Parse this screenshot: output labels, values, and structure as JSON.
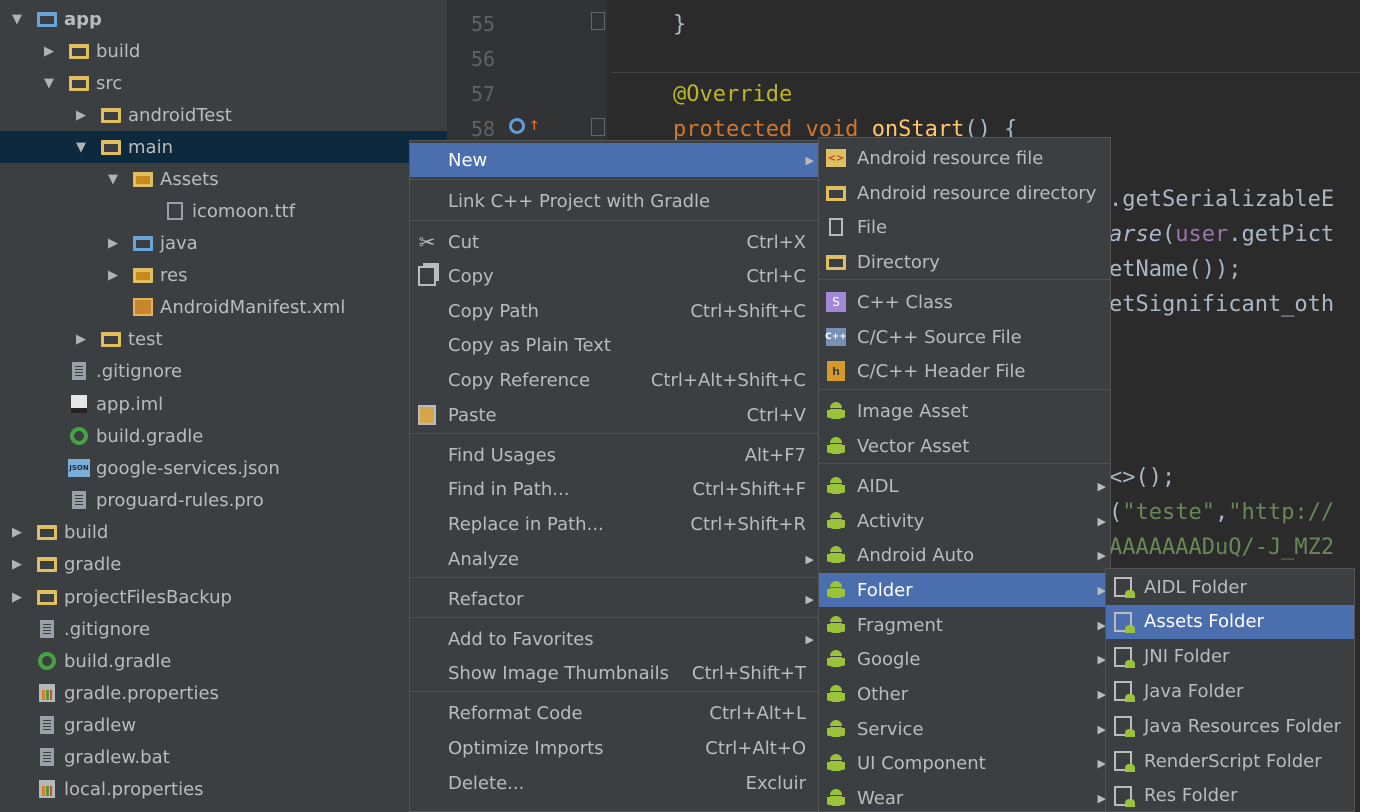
{
  "tree": {
    "items": [
      {
        "label": "app",
        "bold": true,
        "icon": "module-folder-icon",
        "arrow": "expanded"
      },
      {
        "label": "build",
        "icon": "folder-icon",
        "arrow": "collapsed"
      },
      {
        "label": "src",
        "icon": "folder-icon",
        "arrow": "expanded"
      },
      {
        "label": "androidTest",
        "icon": "folder-icon",
        "arrow": "collapsed"
      },
      {
        "label": "main",
        "icon": "folder-icon",
        "arrow": "expanded",
        "selected": true
      },
      {
        "label": "Assets",
        "icon": "assets-folder-icon",
        "arrow": "expanded"
      },
      {
        "label": "icomoon.ttf",
        "icon": "font-file-icon",
        "arrow": "none"
      },
      {
        "label": "java",
        "icon": "source-folder-icon",
        "arrow": "collapsed"
      },
      {
        "label": "res",
        "icon": "resource-folder-icon",
        "arrow": "collapsed"
      },
      {
        "label": "AndroidManifest.xml",
        "icon": "manifest-icon",
        "arrow": "none"
      },
      {
        "label": "test",
        "icon": "folder-icon",
        "arrow": "collapsed"
      },
      {
        "label": ".gitignore",
        "icon": "text-file-icon",
        "arrow": "none"
      },
      {
        "label": "app.iml",
        "icon": "iml-file-icon",
        "arrow": "none"
      },
      {
        "label": "build.gradle",
        "icon": "gradle-icon",
        "arrow": "none"
      },
      {
        "label": "google-services.json",
        "icon": "json-file-icon",
        "arrow": "none"
      },
      {
        "label": "proguard-rules.pro",
        "icon": "text-file-icon",
        "arrow": "none"
      },
      {
        "label": "build",
        "icon": "folder-icon",
        "arrow": "collapsed"
      },
      {
        "label": "gradle",
        "icon": "folder-icon",
        "arrow": "collapsed"
      },
      {
        "label": "projectFilesBackup",
        "icon": "folder-icon",
        "arrow": "collapsed"
      },
      {
        "label": ".gitignore",
        "icon": "text-file-icon",
        "arrow": "none"
      },
      {
        "label": "build.gradle",
        "icon": "gradle-icon",
        "arrow": "none"
      },
      {
        "label": "gradle.properties",
        "icon": "properties-icon",
        "arrow": "none"
      },
      {
        "label": "gradlew",
        "icon": "text-file-icon",
        "arrow": "none"
      },
      {
        "label": "gradlew.bat",
        "icon": "text-file-icon",
        "arrow": "none"
      },
      {
        "label": "local.properties",
        "icon": "properties-icon",
        "arrow": "none"
      }
    ]
  },
  "editor": {
    "line_numbers": [
      "55",
      "56",
      "57",
      "58"
    ],
    "lines": {
      "l55": "}",
      "l57": "@Override",
      "l58_kw": "protected void ",
      "l58_fn": "onStart",
      "l58_rest": "() {",
      "r1": ".getSerializableE",
      "r2a": "arse",
      "r2b": "(",
      "r2c": "user",
      "r2d": ".getPict",
      "r3a": "etName());",
      "r4": "etSignificant_oth",
      "r5": "<>();",
      "r6a": "(",
      "r6b": "\"teste\"",
      "r6c": ",",
      "r6d": "\"http://",
      "r7": "AAAAAAADuQ/-J_MZ2"
    }
  },
  "context_menu": {
    "items": [
      {
        "label": "New",
        "submenu": true,
        "selected": true
      },
      {
        "label": "Link C++ Project with Gradle"
      },
      {
        "label": "Cut",
        "shortcut": "Ctrl+X",
        "icon": "scissors-icon"
      },
      {
        "label": "Copy",
        "shortcut": "Ctrl+C",
        "icon": "copy-icon"
      },
      {
        "label": "Copy Path",
        "shortcut": "Ctrl+Shift+C"
      },
      {
        "label": "Copy as Plain Text"
      },
      {
        "label": "Copy Reference",
        "shortcut": "Ctrl+Alt+Shift+C"
      },
      {
        "label": "Paste",
        "shortcut": "Ctrl+V",
        "icon": "paste-icon"
      },
      {
        "label": "Find Usages",
        "shortcut": "Alt+F7"
      },
      {
        "label": "Find in Path...",
        "shortcut": "Ctrl+Shift+F"
      },
      {
        "label": "Replace in Path...",
        "shortcut": "Ctrl+Shift+R"
      },
      {
        "label": "Analyze",
        "submenu": true
      },
      {
        "label": "Refactor",
        "submenu": true
      },
      {
        "label": "Add to Favorites",
        "submenu": true
      },
      {
        "label": "Show Image Thumbnails",
        "shortcut": "Ctrl+Shift+T"
      },
      {
        "label": "Reformat Code",
        "shortcut": "Ctrl+Alt+L"
      },
      {
        "label": "Optimize Imports",
        "shortcut": "Ctrl+Alt+O"
      },
      {
        "label": "Delete...",
        "shortcut": "Excluir"
      }
    ]
  },
  "new_menu": {
    "items": [
      {
        "label": "Android resource file",
        "icon": "resource-file-icon"
      },
      {
        "label": "Android resource directory",
        "icon": "folder-icon"
      },
      {
        "label": "File",
        "icon": "file-icon"
      },
      {
        "label": "Directory",
        "icon": "folder-icon"
      },
      {
        "label": "C++ Class",
        "icon": "cpp-class-icon"
      },
      {
        "label": "C/C++ Source File",
        "icon": "cpp-source-icon"
      },
      {
        "label": "C/C++ Header File",
        "icon": "cpp-header-icon"
      },
      {
        "label": "Image Asset",
        "icon": "android-icon"
      },
      {
        "label": "Vector Asset",
        "icon": "android-icon"
      },
      {
        "label": "AIDL",
        "icon": "android-icon",
        "submenu": true
      },
      {
        "label": "Activity",
        "icon": "android-icon",
        "submenu": true
      },
      {
        "label": "Android Auto",
        "icon": "android-icon",
        "submenu": true
      },
      {
        "label": "Folder",
        "icon": "android-icon",
        "submenu": true,
        "selected": true
      },
      {
        "label": "Fragment",
        "icon": "android-icon",
        "submenu": true
      },
      {
        "label": "Google",
        "icon": "android-icon",
        "submenu": true
      },
      {
        "label": "Other",
        "icon": "android-icon",
        "submenu": true
      },
      {
        "label": "Service",
        "icon": "android-icon",
        "submenu": true
      },
      {
        "label": "UI Component",
        "icon": "android-icon",
        "submenu": true
      },
      {
        "label": "Wear",
        "icon": "android-icon",
        "submenu": true
      }
    ]
  },
  "folder_menu": {
    "items": [
      {
        "label": "AIDL Folder"
      },
      {
        "label": "Assets Folder",
        "selected": true
      },
      {
        "label": "JNI Folder"
      },
      {
        "label": "Java Folder"
      },
      {
        "label": "Java Resources Folder"
      },
      {
        "label": "RenderScript Folder"
      },
      {
        "label": "Res Folder"
      }
    ]
  }
}
